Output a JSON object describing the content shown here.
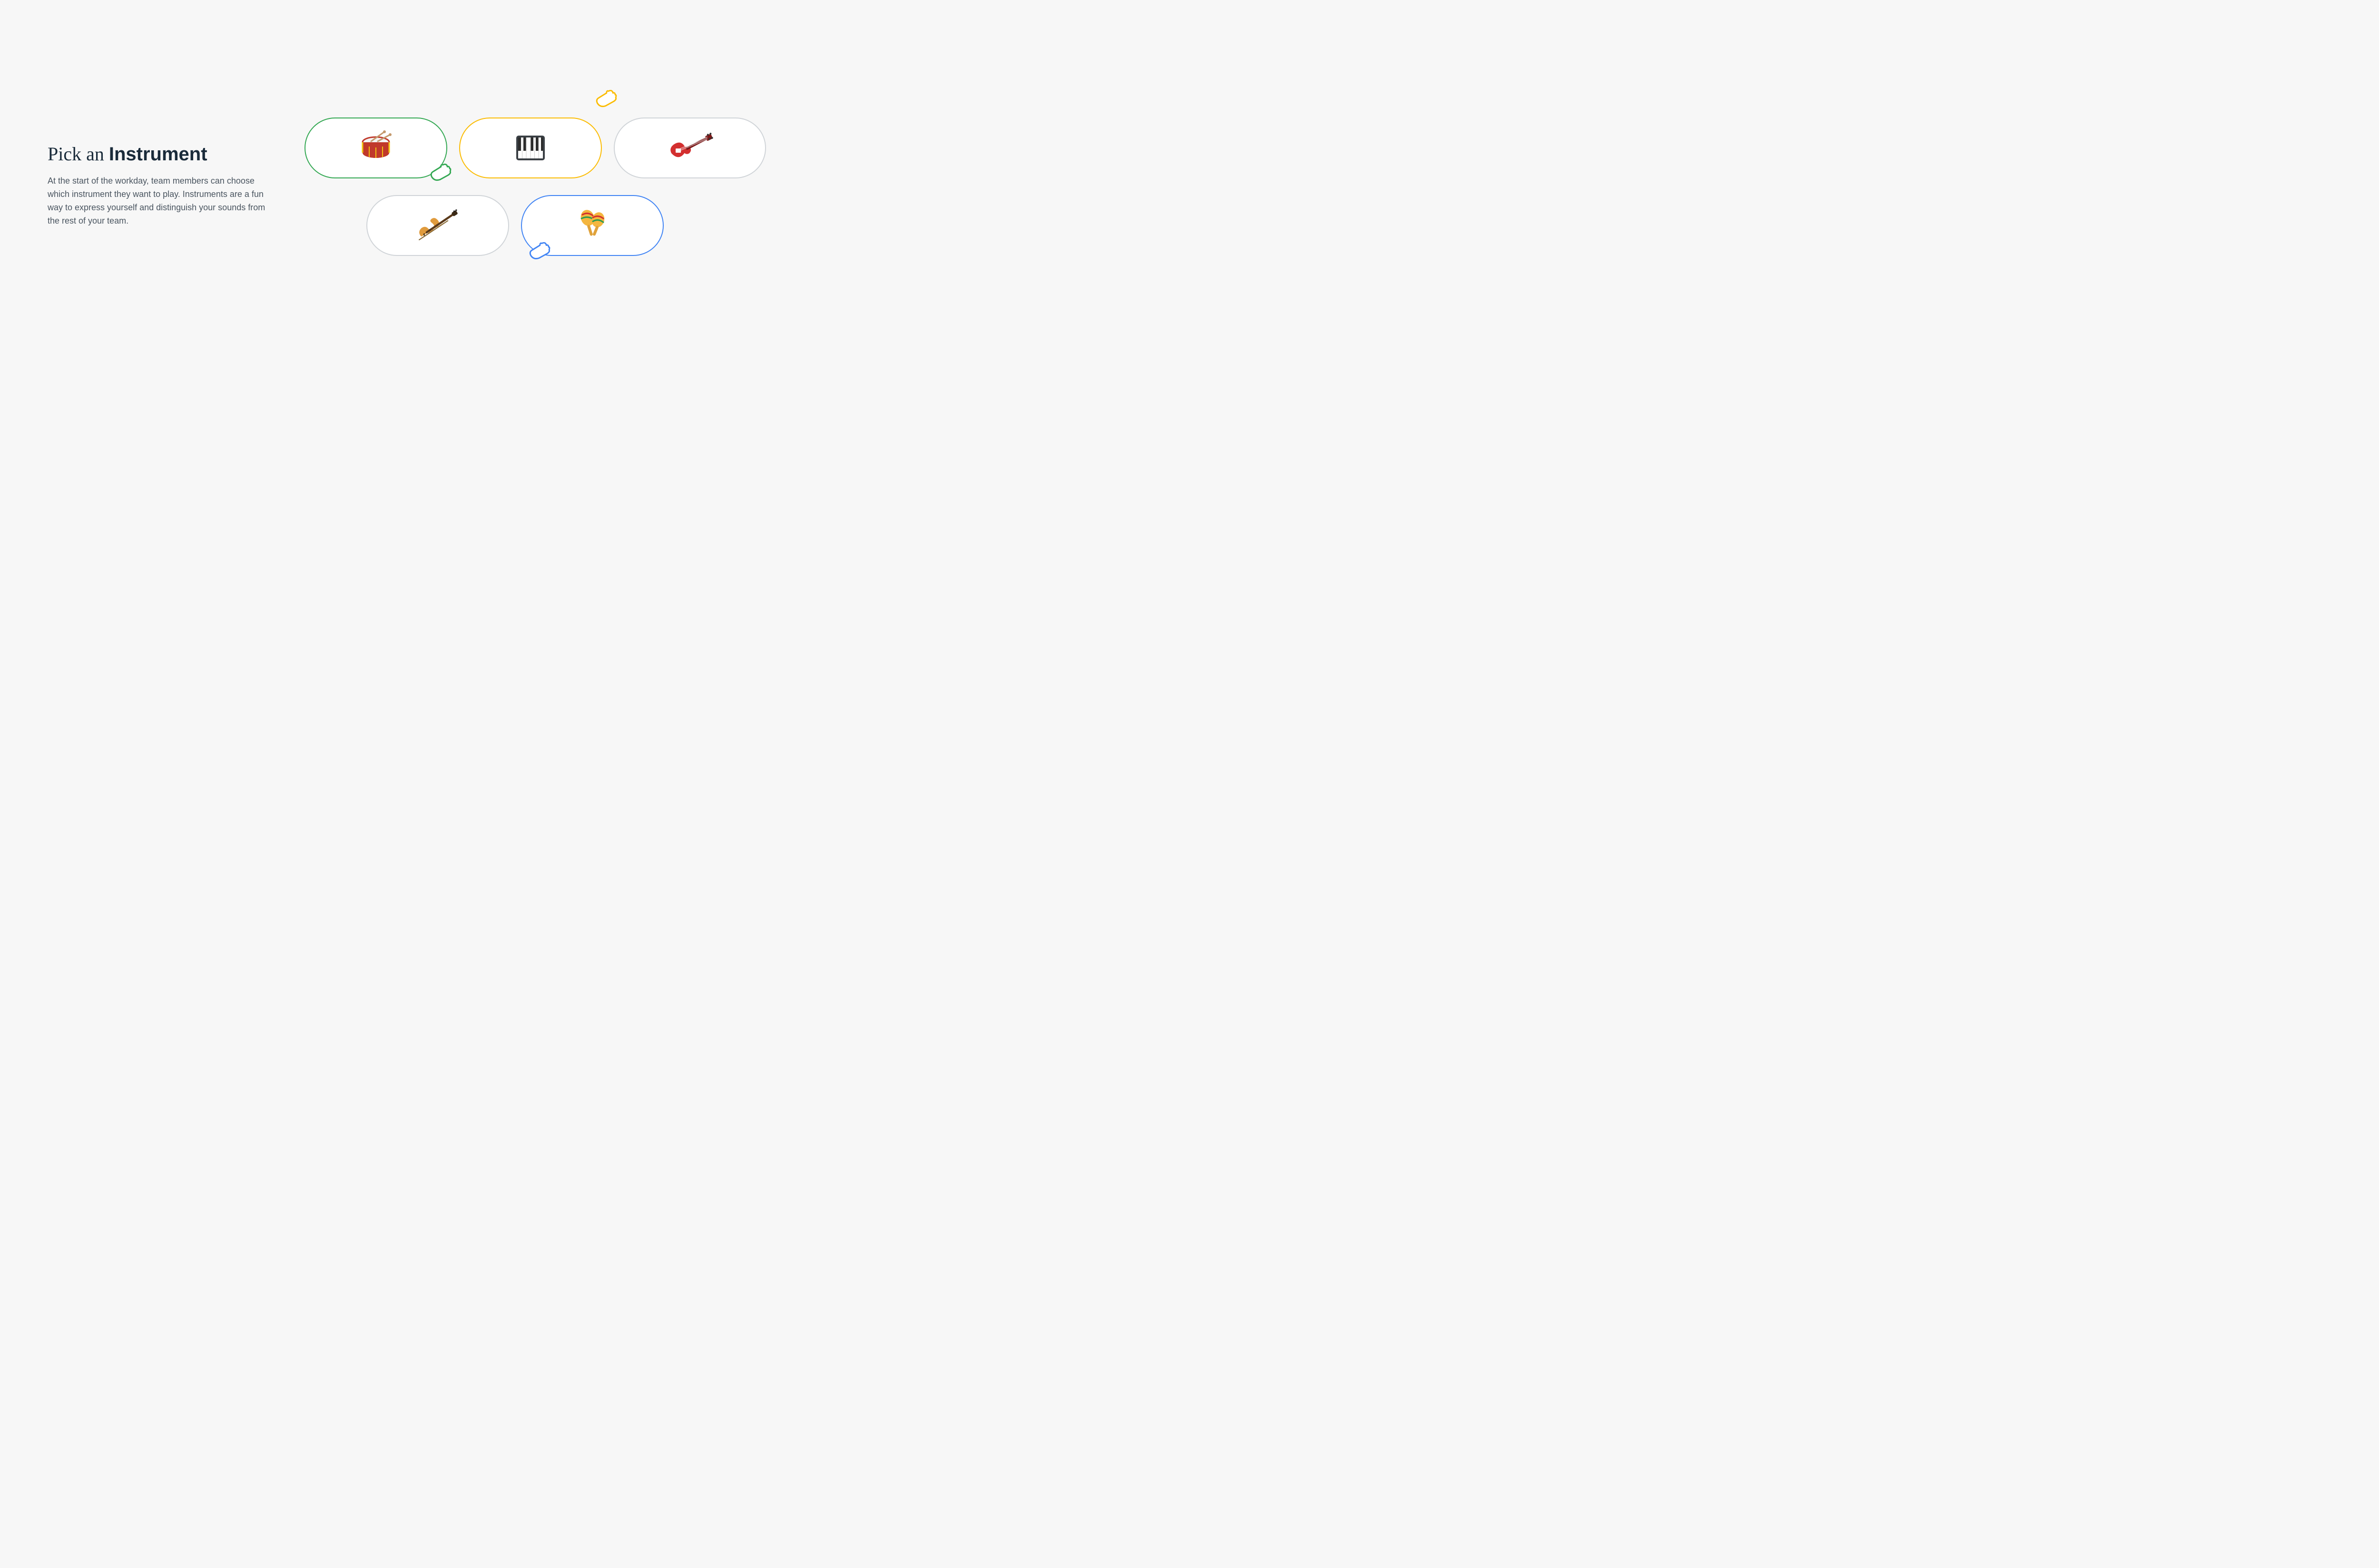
{
  "heading_light": "Pick an ",
  "heading_bold": "Instrument",
  "description": "At the start of the workday, team members can choose which instrument they want to play. Instruments are a fun way to express yourself and distinguish your sounds from the rest of your team.",
  "instruments": {
    "drum": {
      "name": "drum",
      "border": "#34a853"
    },
    "piano": {
      "name": "piano",
      "border": "#fbbc04"
    },
    "guitar": {
      "name": "guitar",
      "border": "#d0d4d8"
    },
    "violin": {
      "name": "violin",
      "border": "#d0d4d8"
    },
    "maracas": {
      "name": "maracas",
      "border": "#4285f4"
    }
  },
  "cursors": {
    "yellow": "#fbbc04",
    "green": "#34a853",
    "blue": "#4285f4"
  }
}
